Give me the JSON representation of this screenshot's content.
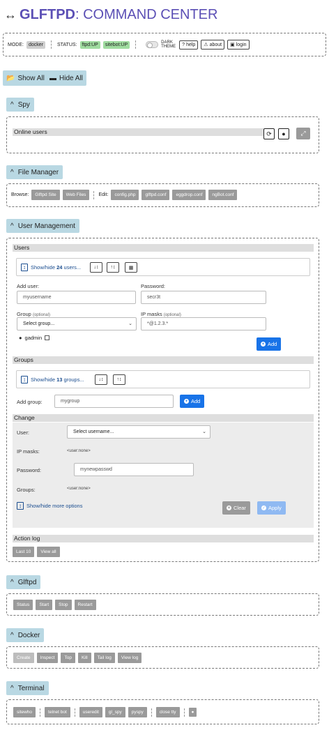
{
  "header": {
    "arrows_icon": "↔",
    "brand": "GLFTPD",
    "rest": ": COMMAND CENTER"
  },
  "modebar": {
    "mode_label": "MODE:",
    "mode_value": "docker",
    "status_label": "STATUS:",
    "ftpd_status": "ftpd:UP",
    "sitebot_status": "sitebot:UP",
    "dark_theme_label": "DARK THEME",
    "help_label": "help",
    "about_label": "about",
    "login_label": "login"
  },
  "top_buttons": {
    "show_all": "Show All",
    "hide_all": "Hide All"
  },
  "spy": {
    "header": "Spy",
    "online_users": "Online users"
  },
  "file_manager": {
    "header": "File Manager",
    "browse_label": "Browse:",
    "browse_items": [
      "Glftpd Site",
      "Web Files"
    ],
    "edit_label": "Edit:",
    "edit_items": [
      "config.php",
      "glftpd.conf",
      "eggdrop.conf",
      "ngBot.conf"
    ]
  },
  "user_management": {
    "header": "User Management",
    "users_title": "Users",
    "show_users": {
      "prefix": "Show/hide ",
      "count": "24",
      "suffix": " users..."
    },
    "add_user_label": "Add user:",
    "add_user_placeholder": "myusername",
    "password_label": "Password:",
    "password_value": "secr3t",
    "group_label": "Group",
    "group_optional": "(optional)",
    "group_select": "Select group...",
    "ipmasks_label": "IP masks",
    "ipmasks_optional": "(optional)",
    "ipmasks_value": "*@1.2.3.*",
    "gadmin_label": "gadmin",
    "add_button": "Add",
    "groups_title": "Groups",
    "show_groups": {
      "prefix": "Show/hide ",
      "count": "13",
      "suffix": " groups..."
    },
    "add_group_label": "Add group:",
    "add_group_placeholder": "mygroup",
    "add_group_button": "Add",
    "change_title": "Change",
    "change_user_label": "User:",
    "change_user_select": "Select username...",
    "change_ipmasks_label": "IP masks:",
    "change_ipmasks_value": "<user:none>",
    "change_password_label": "Password:",
    "change_password_placeholder": "mynewpasswd",
    "change_groups_label": "Groups:",
    "change_groups_value": "<user:none>",
    "more_options": "Show/hide more options",
    "clear_button": "Clear",
    "apply_button": "Apply",
    "action_log_title": "Action log",
    "action_log_buttons": [
      "Last 10",
      "View all"
    ]
  },
  "glftpd": {
    "header": "Glftpd",
    "buttons": [
      "Status",
      "Start",
      "Stop",
      "Restart"
    ]
  },
  "docker": {
    "header": "Docker",
    "buttons": [
      "Create",
      "Inspect",
      "Top",
      "Kill",
      "Tail log",
      "View log"
    ]
  },
  "terminal": {
    "header": "Terminal",
    "buttons_a": [
      "sitewho"
    ],
    "buttons_b": [
      "telnet bot"
    ],
    "buttons_c": [
      "useredit",
      "gl_spy",
      "pyspy"
    ],
    "buttons_d": [
      "close tty"
    ]
  },
  "colors": {
    "accent_blue": "#1873e8",
    "header_blue": "#b9d8e3",
    "brand_purple": "#5b4fb5",
    "status_green": "#9fdc9f"
  }
}
